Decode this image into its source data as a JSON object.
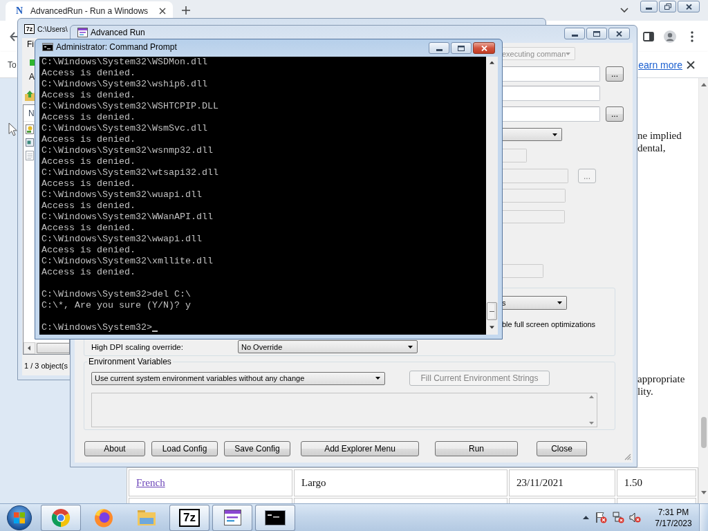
{
  "browser": {
    "active": false,
    "tab": {
      "favicon": "N",
      "title": "AdvancedRun - Run a Windows",
      "selected": true
    },
    "infobar": {
      "text": "To",
      "link": "earn more"
    },
    "page": {
      "paragraphs": [
        [
          "ne implied",
          "dental,"
        ],
        [
          "appropriate",
          "lity."
        ]
      ],
      "table": {
        "rows": [
          [
            {
              "kind": "link",
              "text": "French"
            },
            {
              "kind": "text",
              "text": "Largo"
            },
            {
              "kind": "text",
              "text": "23/11/2021"
            },
            {
              "kind": "text",
              "text": "1.50"
            }
          ]
        ]
      }
    }
  },
  "archiver_window": {
    "active": false,
    "logo": "7z",
    "title": "C:\\Users\\",
    "menu": [
      "Fi"
    ],
    "toolbar": [
      "A"
    ],
    "list": {
      "columns": [
        "N"
      ],
      "rows": [
        {
          "kind": "script"
        },
        {
          "kind": "program"
        },
        {
          "kind": "text"
        }
      ]
    },
    "status_bar": "1 / 3 object(s"
  },
  "advanced_run": {
    "active": false,
    "title": "Advanced Run",
    "rows": [
      [
        {
          "kind": "dropdown",
          "value": "executing comman",
          "disabled": true
        }
      ],
      [
        {
          "kind": "field",
          "disabled": false
        },
        {
          "kind": "button",
          "label": "...",
          "disabled": false
        }
      ],
      [
        {
          "kind": "field",
          "disabled": false
        }
      ],
      [
        {
          "kind": "field",
          "disabled": false
        },
        {
          "kind": "button",
          "label": "...",
          "disabled": false
        }
      ],
      [
        {
          "kind": "dropdown",
          "disabled": false
        }
      ],
      [
        {
          "kind": "field",
          "disabled": true
        }
      ],
      [
        {
          "kind": "field",
          "disabled": true
        },
        {
          "kind": "button",
          "label": "...",
          "disabled": true
        }
      ],
      [
        {
          "kind": "field",
          "disabled": true
        }
      ],
      [
        {
          "kind": "field",
          "disabled": true
        }
      ],
      [
        {
          "kind": "field",
          "disabled": true
        }
      ]
    ],
    "compatibility": {
      "mode": {
        "value": "s",
        "disabled": false
      },
      "option": "ble full screen optimizations",
      "high_dpi": {
        "label": "High DPI scaling override:",
        "value": "No Override"
      }
    },
    "environment": {
      "title": "Environment Variables",
      "mode": "Use current system environment variables without any change",
      "fill_button": {
        "label": "Fill Current Environment Strings",
        "disabled": true
      },
      "strings": {
        "disabled": true
      }
    },
    "buttons": [
      "About",
      "Load Config",
      "Save Config",
      "Add Explorer Menu",
      "Run",
      "Close"
    ]
  },
  "console": {
    "active": true,
    "title": "Administrator: Command Prompt",
    "blocks": [
      [
        "C:\\Windows\\System32\\WSDMon.dll",
        "Access is denied.",
        "C:\\Windows\\System32\\wship6.dll",
        "Access is denied.",
        "C:\\Windows\\System32\\WSHTCPIP.DLL",
        "Access is denied.",
        "C:\\Windows\\System32\\WsmSvc.dll",
        "Access is denied.",
        "C:\\Windows\\System32\\wsnmp32.dll",
        "Access is denied.",
        "C:\\Windows\\System32\\wtsapi32.dll",
        "Access is denied.",
        "C:\\Windows\\System32\\wuapi.dll",
        "Access is denied.",
        "C:\\Windows\\System32\\WWanAPI.dll",
        "Access is denied.",
        "C:\\Windows\\System32\\wwapi.dll",
        "Access is denied.",
        "C:\\Windows\\System32\\xmllite.dll",
        "Access is denied."
      ],
      [
        "C:\\Windows\\System32>del C:\\",
        "C:\\*, Are you sure (Y/N)? y"
      ],
      [
        "C:\\Windows\\System32>"
      ]
    ]
  },
  "taskbar": {
    "apps": [
      {
        "kind": "chrome",
        "running": true
      },
      {
        "kind": "firefox",
        "running": false
      },
      {
        "kind": "explorer",
        "running": false
      },
      {
        "kind": "archiver",
        "logo": "7z",
        "running": true
      },
      {
        "kind": "advancedrun",
        "running": true
      },
      {
        "kind": "console",
        "running": true
      }
    ],
    "clock": {
      "time": "7:31 PM",
      "date": "7/17/2023"
    }
  }
}
